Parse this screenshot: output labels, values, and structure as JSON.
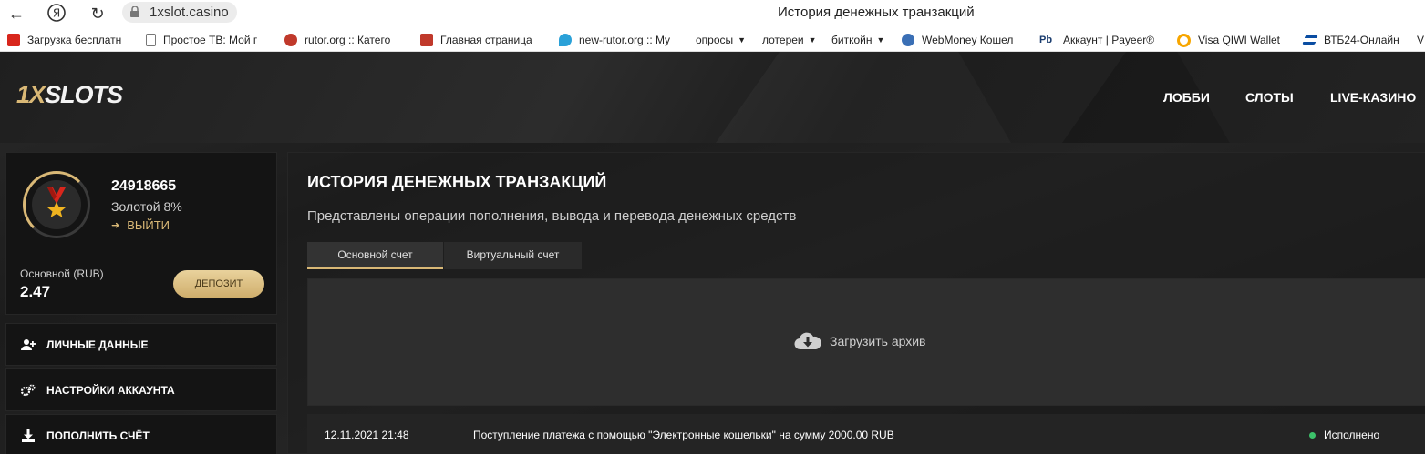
{
  "browser": {
    "url": "1xslot.casino",
    "tab_title": "История денежных транзакций",
    "bookmarks": [
      {
        "label": "Загрузка бесплатн",
        "icon": "adobe-icon",
        "color": "#d8261c"
      },
      {
        "label": "Простое ТВ: Мой г",
        "icon": "page-icon",
        "color": "#777777"
      },
      {
        "label": "rutor.org :: Катего",
        "icon": "rutor-icon",
        "color": "#c0392b"
      },
      {
        "label": "Главная страница",
        "icon": "site-icon",
        "color": "#c0392b"
      },
      {
        "label": "new-rutor.org :: Мy",
        "icon": "pin-icon",
        "color": "#2aa1d8"
      },
      {
        "label": "опросы",
        "icon": "folder-icon",
        "dropdown": true
      },
      {
        "label": "лотереи",
        "icon": "folder-icon",
        "dropdown": true
      },
      {
        "label": "биткойн",
        "icon": "folder-icon",
        "dropdown": true
      },
      {
        "label": "WebMoney Кошел",
        "icon": "webmoney-icon",
        "color": "#3a6fb5"
      },
      {
        "label": "Аккаунт | Payeer®",
        "icon": "payeer-icon",
        "color": "#1a3c6e",
        "glyph": "Pb"
      },
      {
        "label": "Visa QIWI Wallet",
        "icon": "qiwi-icon",
        "color": "#f7a600"
      },
      {
        "label": "ВТБ24-Онлайн",
        "icon": "vtb-icon",
        "color": "#0a4da2"
      },
      {
        "label": "V",
        "icon": "",
        "color": ""
      }
    ]
  },
  "header": {
    "logo_part1": "1X",
    "logo_part2": "SLOTS",
    "nav": [
      "ЛОББИ",
      "СЛОТЫ",
      "LIVE-КАЗИНО"
    ]
  },
  "profile": {
    "user_id": "24918665",
    "level": "Золотой 8%",
    "logout_label": "ВЫЙТИ",
    "balance_label": "Основной (RUB)",
    "balance_value": "2.47",
    "deposit_label": "ДЕПОЗИТ"
  },
  "sidebar": {
    "items": [
      {
        "label": "ЛИЧНЫЕ ДАННЫЕ",
        "icon": "user-add-icon"
      },
      {
        "label": "НАСТРОЙКИ АККАУНТА",
        "icon": "settings-icon"
      },
      {
        "label": "ПОПОЛНИТЬ СЧЁТ",
        "icon": "download-icon"
      }
    ]
  },
  "main": {
    "title": "ИСТОРИЯ ДЕНЕЖНЫХ ТРАНЗАКЦИЙ",
    "subtitle": "Представлены операции пополнения, вывода и перевода денежных средств",
    "tabs": [
      "Основной счет",
      "Виртуальный счет"
    ],
    "archive_label": "Загрузить архив",
    "transactions": [
      {
        "date": "12.11.2021 21:48",
        "description": "Поступление платежа с помощью \"Электронные кошельки\" на сумму 2000.00 RUB",
        "status": "Исполнено",
        "status_color": "#3cc26a"
      }
    ]
  },
  "colors": {
    "accent": "#d9b876",
    "background": "#1a1a1a"
  }
}
